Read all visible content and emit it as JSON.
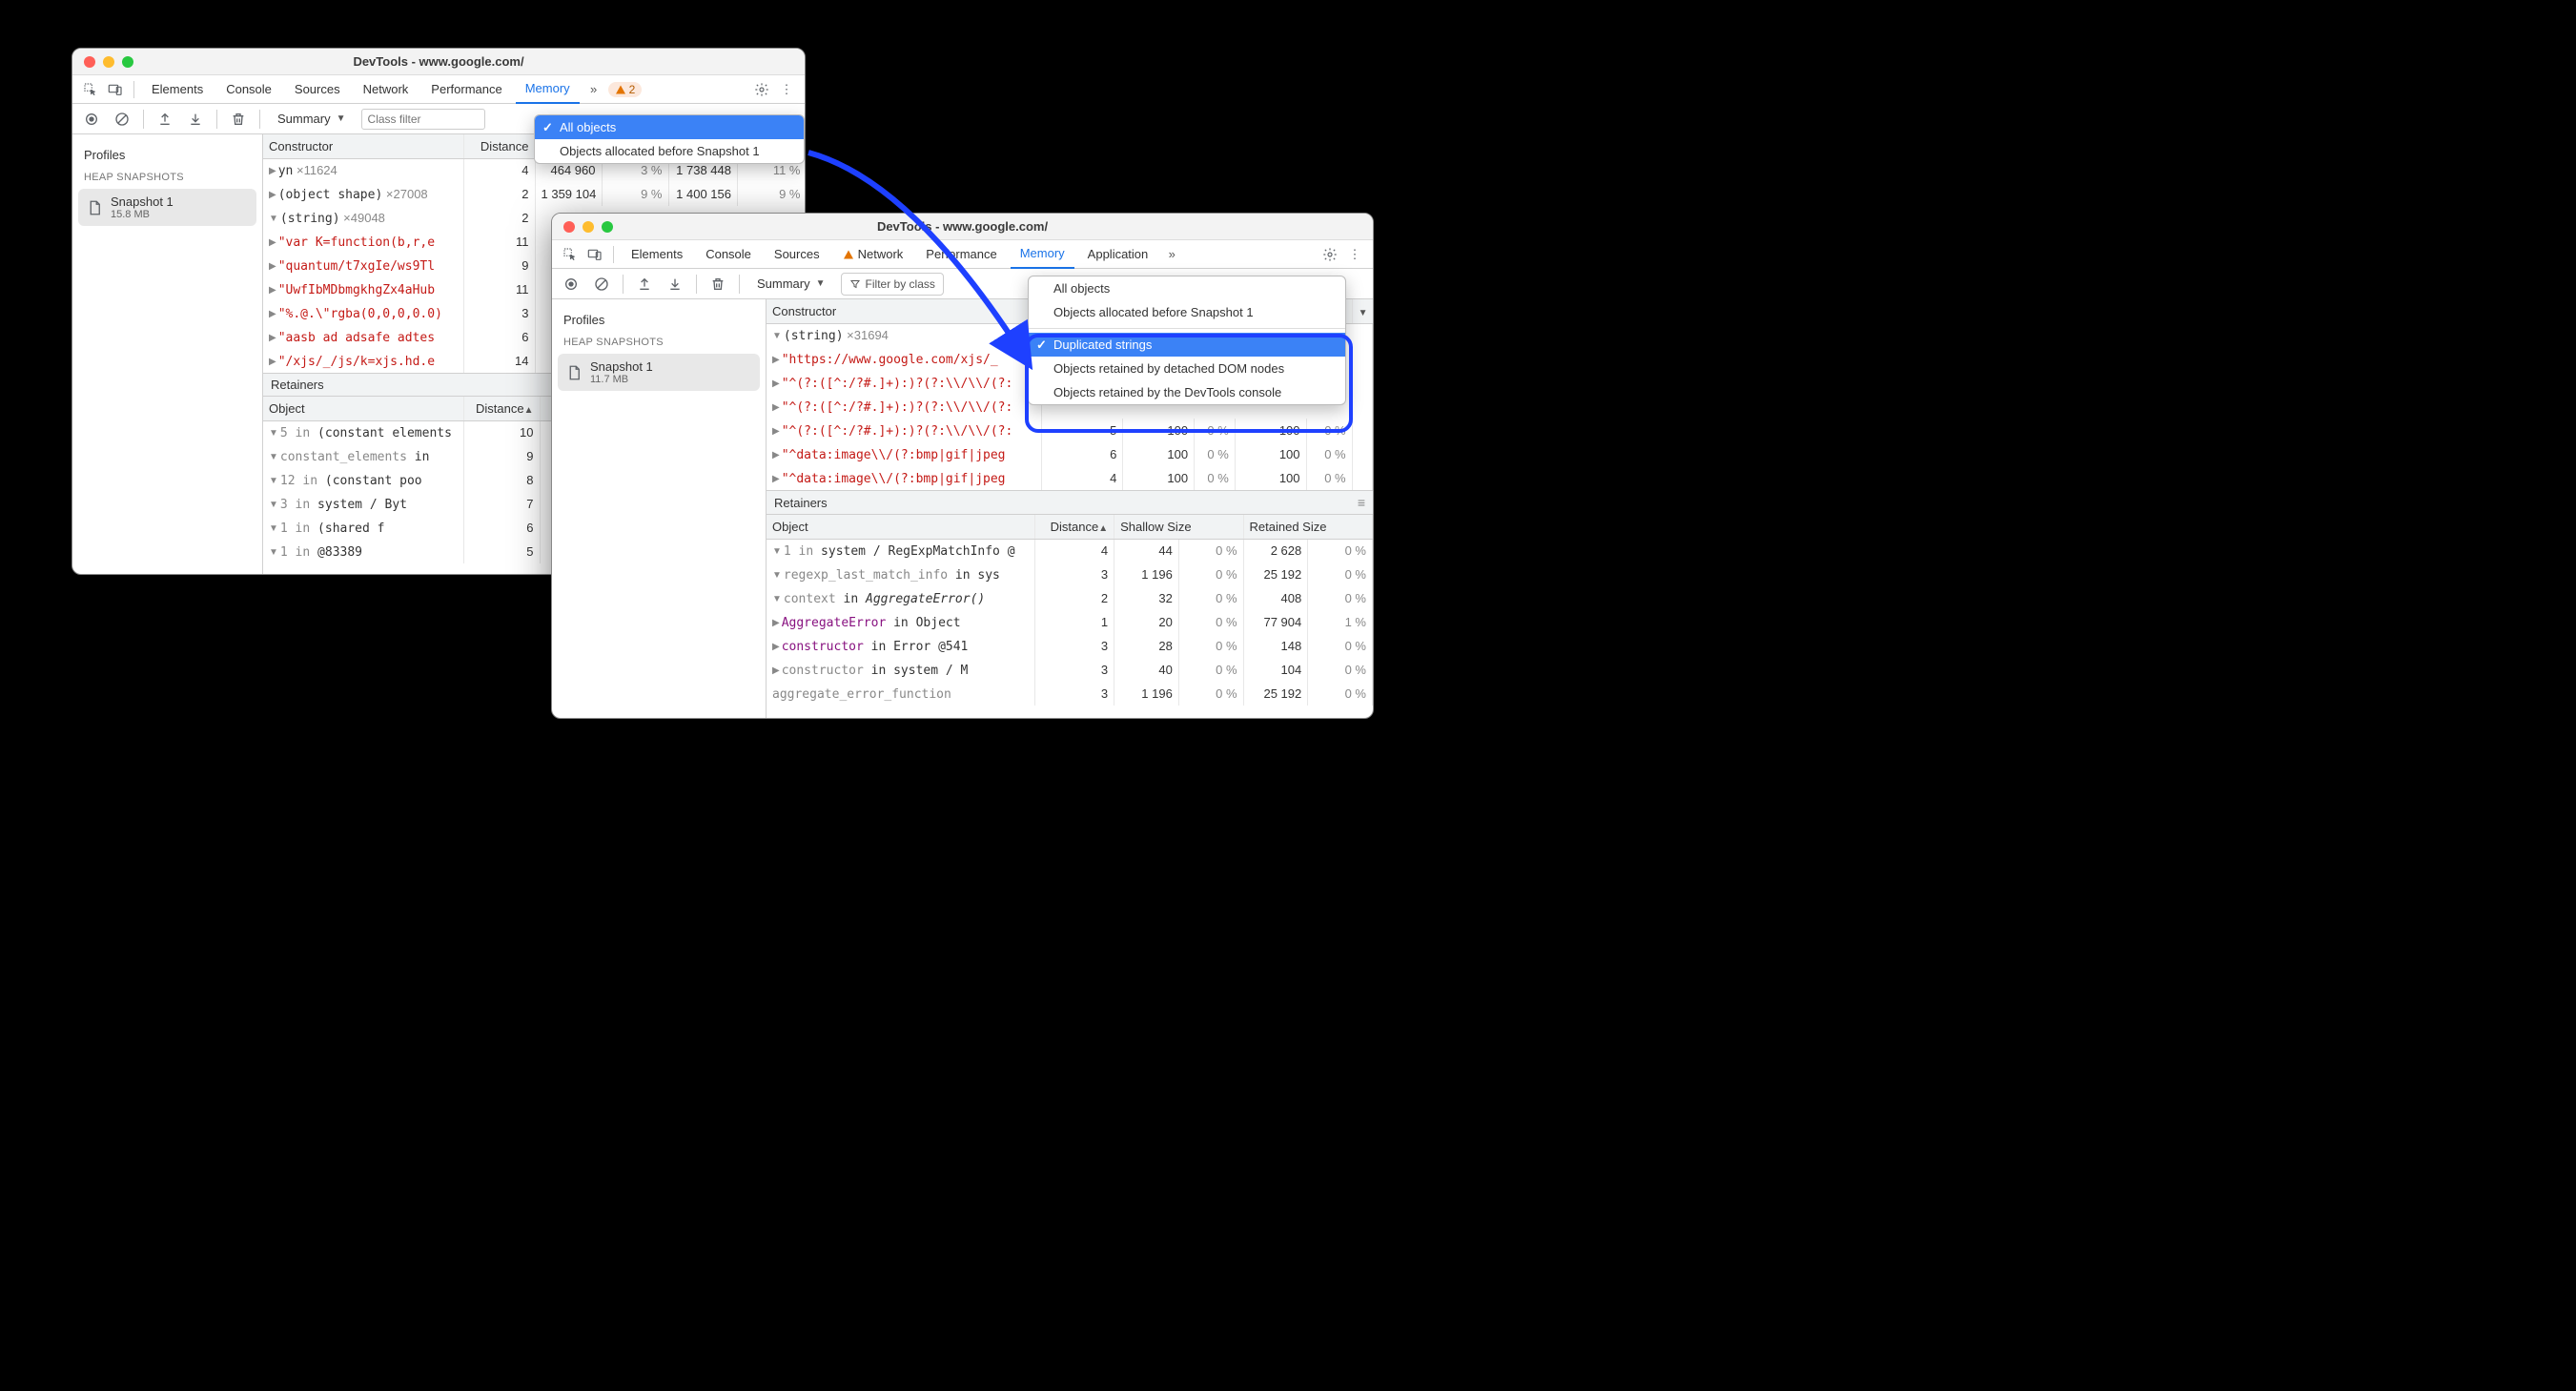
{
  "w1": {
    "title": "DevTools - www.google.com/",
    "tabs": [
      "Elements",
      "Console",
      "Sources",
      "Network",
      "Performance",
      "Memory"
    ],
    "active_tab": "Memory",
    "warn_count": "2",
    "toolbar": {
      "summary_label": "Summary",
      "classfilter_placeholder": "Class filter"
    },
    "dropdown": {
      "items": [
        "All objects",
        "Objects allocated before Snapshot 1"
      ],
      "selected": "All objects"
    },
    "sidebar": {
      "profiles_label": "Profiles",
      "section_label": "HEAP SNAPSHOTS",
      "snapshot_name": "Snapshot 1",
      "snapshot_size": "15.8 MB"
    },
    "cols": {
      "constructor": "Constructor",
      "distance": "Distance"
    },
    "rows": [
      {
        "i": 0,
        "tri": "▶",
        "name": "yn",
        "mult": "×11624",
        "dist": "4",
        "shallow": "464 960",
        "shp": "3 %",
        "ret": "1 738 448",
        "rp": "11 %"
      },
      {
        "i": 0,
        "tri": "▶",
        "name": "(object shape)",
        "mult": "×27008",
        "dist": "2",
        "shallow": "1 359 104",
        "shp": "9 %",
        "ret": "1 400 156",
        "rp": "9 %"
      },
      {
        "i": 0,
        "tri": "▼",
        "name": "(string)",
        "mult": "×49048",
        "dist": "2"
      },
      {
        "i": 1,
        "tri": "▶",
        "str": "\"var K=function(b,r,e",
        "dist": "11"
      },
      {
        "i": 1,
        "tri": "▶",
        "str": "\"quantum/t7xgIe/ws9Tl",
        "dist": "9"
      },
      {
        "i": 1,
        "tri": "▶",
        "str": "\"UwfIbMDbmgkhgZx4aHub",
        "dist": "11"
      },
      {
        "i": 1,
        "tri": "▶",
        "str": "\"%.@.\\\"rgba(0,0,0,0.0)",
        "dist": "3"
      },
      {
        "i": 1,
        "tri": "▶",
        "str": "\"aasb ad adsafe adtes",
        "dist": "6"
      },
      {
        "i": 1,
        "tri": "▶",
        "str": "\"/xjs/_/js/k=xjs.hd.e",
        "dist": "14"
      }
    ],
    "retainers_label": "Retainers",
    "ret_cols": {
      "object": "Object",
      "distance": "Distance"
    },
    "ret_rows": [
      {
        "i": 0,
        "tri": "▼",
        "pre": "5 in ",
        "code": "(constant elements",
        "dist": "10"
      },
      {
        "i": 1,
        "tri": "▼",
        "pre": "",
        "code": "constant_elements",
        "post": " in",
        "gray": true,
        "dist": "9"
      },
      {
        "i": 2,
        "tri": "▼",
        "pre": "12 in ",
        "code": "(constant poo",
        "dist": "8"
      },
      {
        "i": 3,
        "tri": "▼",
        "pre": "3 in ",
        "code": "system / Byt",
        "dist": "7"
      },
      {
        "i": 4,
        "tri": "▼",
        "pre": "1 in ",
        "code": "(shared f",
        "dist": "6"
      },
      {
        "i": 5,
        "tri": "▼",
        "pre": "1 in ",
        "code": "@83389",
        "dist": "5"
      }
    ]
  },
  "w2": {
    "title": "DevTools - www.google.com/",
    "tabs": [
      "Elements",
      "Console",
      "Sources",
      "Network",
      "Performance",
      "Memory",
      "Application"
    ],
    "active_tab": "Memory",
    "warn_in_tab": "Network",
    "toolbar": {
      "summary_label": "Summary",
      "filter_label": "Filter by class"
    },
    "dropdown": {
      "items": [
        "All objects",
        "Objects allocated before Snapshot 1",
        "Duplicated strings",
        "Objects retained by detached DOM nodes",
        "Objects retained by the DevTools console"
      ],
      "selected": "Duplicated strings"
    },
    "sidebar": {
      "profiles_label": "Profiles",
      "section_label": "HEAP SNAPSHOTS",
      "snapshot_name": "Snapshot 1",
      "snapshot_size": "11.7 MB"
    },
    "cols": {
      "constructor": "Constructor"
    },
    "rows": [
      {
        "i": 0,
        "tri": "▼",
        "name": "(string)",
        "mult": "×31694"
      },
      {
        "i": 1,
        "tri": "▶",
        "str": "\"https://www.google.com/xjs/_"
      },
      {
        "i": 1,
        "tri": "▶",
        "str": "\"^(?:([^:/?#.]+):)?(?:\\\\/\\\\/(?:"
      },
      {
        "i": 1,
        "tri": "▶",
        "str": "\"^(?:([^:/?#.]+):)?(?:\\\\/\\\\/(?:"
      },
      {
        "i": 1,
        "tri": "▶",
        "str": "\"^(?:([^:/?#.]+):)?(?:\\\\/\\\\/(?:",
        "dist": "5",
        "shallow": "100",
        "shp": "0 %",
        "ret": "100",
        "rp": "0 %"
      },
      {
        "i": 1,
        "tri": "▶",
        "str": "\"^data:image\\\\/(?:bmp|gif|jpeg",
        "dist": "6",
        "shallow": "100",
        "shp": "0 %",
        "ret": "100",
        "rp": "0 %"
      },
      {
        "i": 1,
        "tri": "▶",
        "str": "\"^data:image\\\\/(?:bmp|gif|jpeg",
        "dist": "4",
        "shallow": "100",
        "shp": "0 %",
        "ret": "100",
        "rp": "0 %"
      }
    ],
    "retainers_label": "Retainers",
    "ret_cols": {
      "object": "Object",
      "distance": "Distance",
      "shallow": "Shallow Size",
      "retained": "Retained Size"
    },
    "ret_rows": [
      {
        "i": 0,
        "tri": "▼",
        "pre": "1 in ",
        "code": "system / RegExpMatchInfo @",
        "gray": true,
        "dist": "4",
        "sh": "44",
        "shp": "0 %",
        "ret": "2 628",
        "rp": "0 %"
      },
      {
        "i": 1,
        "tri": "▼",
        "pre": "",
        "code": "regexp_last_match_info",
        "post": " in sys",
        "codegray": true,
        "dist": "3",
        "sh": "1 196",
        "shp": "0 %",
        "ret": "25 192",
        "rp": "0 %"
      },
      {
        "i": 2,
        "tri": "▼",
        "pre": "",
        "code": "context",
        "post": " in ",
        "ital": "AggregateError()",
        "codegray": true,
        "dist": "2",
        "sh": "32",
        "shp": "0 %",
        "ret": "408",
        "rp": "0 %"
      },
      {
        "i": 3,
        "tri": "▶",
        "pre": "",
        "prop": "AggregateError",
        "post": " in Object",
        "dist": "1",
        "sh": "20",
        "shp": "0 %",
        "ret": "77 904",
        "rp": "1 %"
      },
      {
        "i": 3,
        "tri": "▶",
        "pre": "",
        "prop": "constructor",
        "post": " in Error @541",
        "dist": "3",
        "sh": "28",
        "shp": "0 %",
        "ret": "148",
        "rp": "0 %"
      },
      {
        "i": 3,
        "tri": "▶",
        "pre": "",
        "code": "constructor",
        "post": " in system / M",
        "codegray": true,
        "dist": "3",
        "sh": "40",
        "shp": "0 %",
        "ret": "104",
        "rp": "0 %"
      },
      {
        "i": 4,
        "tri": "",
        "pre": "",
        "code": "aggregate_error_function",
        "codegray": true,
        "dist": "3",
        "sh": "1 196",
        "shp": "0 %",
        "ret": "25 192",
        "rp": "0 %"
      }
    ]
  }
}
